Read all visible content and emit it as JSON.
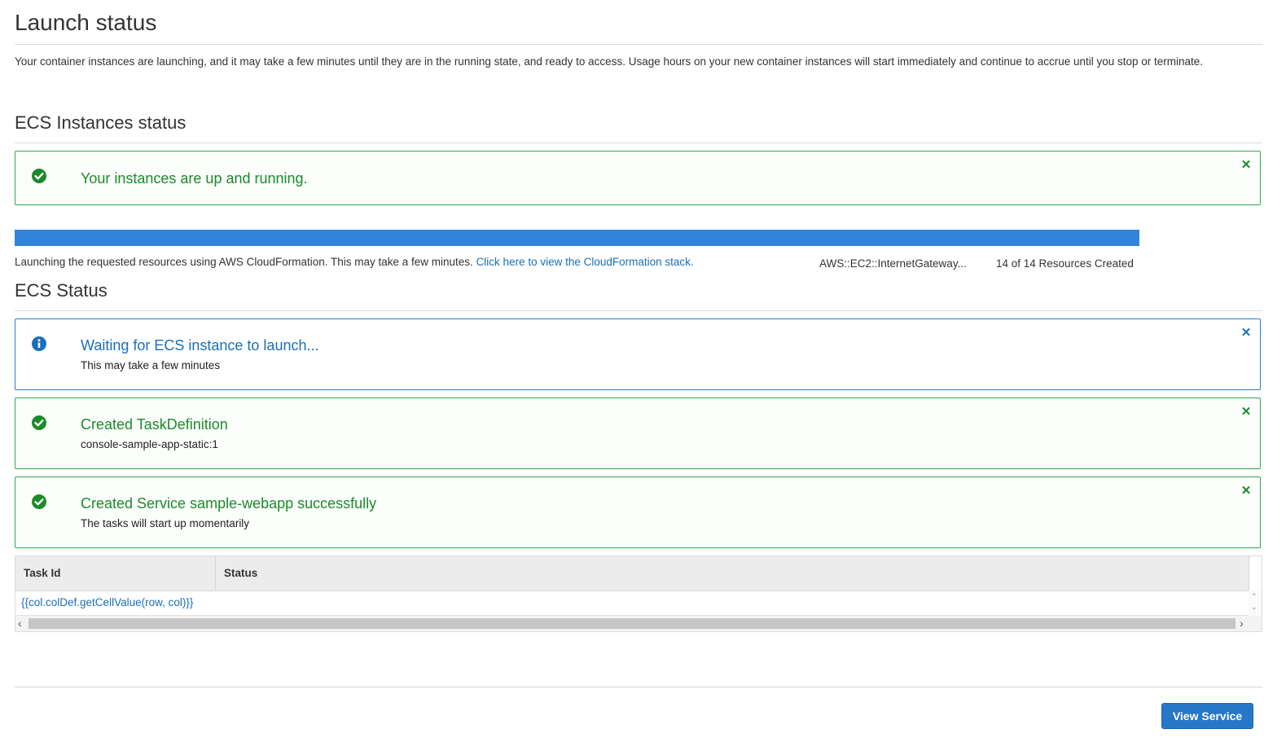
{
  "page": {
    "title": "Launch status",
    "intro": "Your container instances are launching, and it may take a few minutes until they are in the running state, and ready to access. Usage hours on your new container instances will start immediately and continue to accrue until you stop or terminate."
  },
  "instances_section": {
    "heading": "ECS Instances status",
    "alert": {
      "title": "Your instances are up and running.",
      "icon": "check-circle-icon",
      "close_icon": "close-icon"
    }
  },
  "cloudformation": {
    "progress_fraction": 1.0,
    "message": "Launching the requested resources using AWS CloudFormation. This may take a few minutes.",
    "link_text": "Click here to view the CloudFormation stack.",
    "resource_name": "AWS::EC2::InternetGateway...",
    "resource_count": "14 of 14 Resources Created"
  },
  "ecs_section": {
    "heading": "ECS Status",
    "alerts": [
      {
        "type": "info",
        "icon": "info-circle-icon",
        "title": "Waiting for ECS instance to launch...",
        "sub": "This may take a few minutes"
      },
      {
        "type": "success",
        "icon": "check-circle-icon",
        "title": "Created TaskDefinition",
        "sub": "console-sample-app-static:1"
      },
      {
        "type": "success",
        "icon": "check-circle-icon",
        "title": "Created Service sample-webapp successfully",
        "sub": "The tasks will start up momentarily"
      }
    ]
  },
  "task_table": {
    "columns": [
      "Task Id",
      "Status"
    ],
    "rows": [
      {
        "task_id": "{{col.colDef.getCellValue(row, col)}}",
        "status": ""
      }
    ],
    "scroll_left": "‹",
    "scroll_right": "›",
    "scroll_up": "⌃",
    "scroll_down": "⌄"
  },
  "footer": {
    "view_service_label": "View Service"
  },
  "colors": {
    "success": "#1d8a2a",
    "info": "#1a6fb8",
    "primary_button": "#2777c8",
    "progress": "#3184dc"
  }
}
